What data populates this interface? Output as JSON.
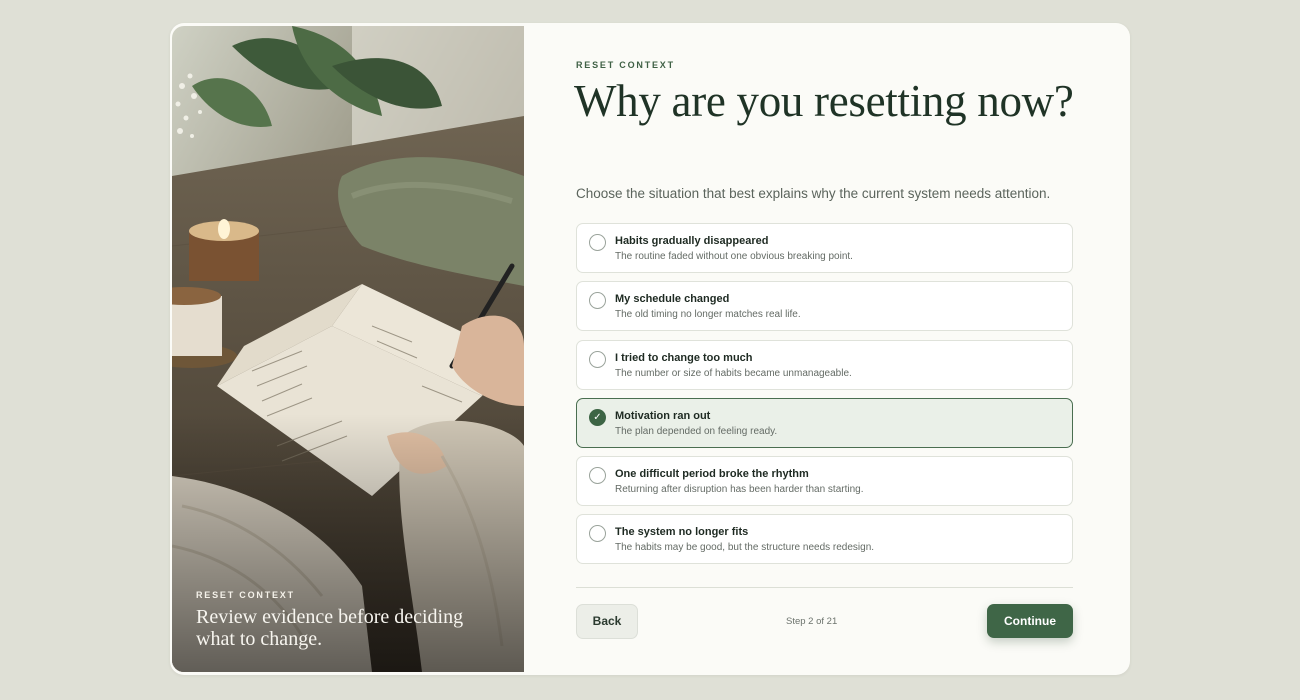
{
  "side_panel": {
    "eyebrow": "RESET CONTEXT",
    "caption": "Review evidence before deciding what to change."
  },
  "main": {
    "eyebrow": "RESET CONTEXT",
    "title": "Why are you resetting now?",
    "subtitle": "Choose the situation that best explains why the current system needs attention.",
    "options": [
      {
        "label": "Habits gradually disappeared",
        "description": "The routine faded without one obvious breaking point.",
        "selected": false
      },
      {
        "label": "My schedule changed",
        "description": "The old timing no longer matches real life.",
        "selected": false
      },
      {
        "label": "I tried to change too much",
        "description": "The number or size of habits became unmanageable.",
        "selected": false
      },
      {
        "label": "Motivation ran out",
        "description": "The plan depended on feeling ready.",
        "selected": true
      },
      {
        "label": "One difficult period broke the rhythm",
        "description": "Returning after disruption has been harder than starting.",
        "selected": false
      },
      {
        "label": "The system no longer fits",
        "description": "The habits may be good, but the structure needs redesign.",
        "selected": false
      }
    ]
  },
  "footer": {
    "back_label": "Back",
    "step_text": "Step 2 of 21",
    "continue_label": "Continue"
  },
  "colors": {
    "accent": "#3f6647",
    "selected_bg": "#eaf0e8",
    "page_bg": "#dfe0d6"
  }
}
